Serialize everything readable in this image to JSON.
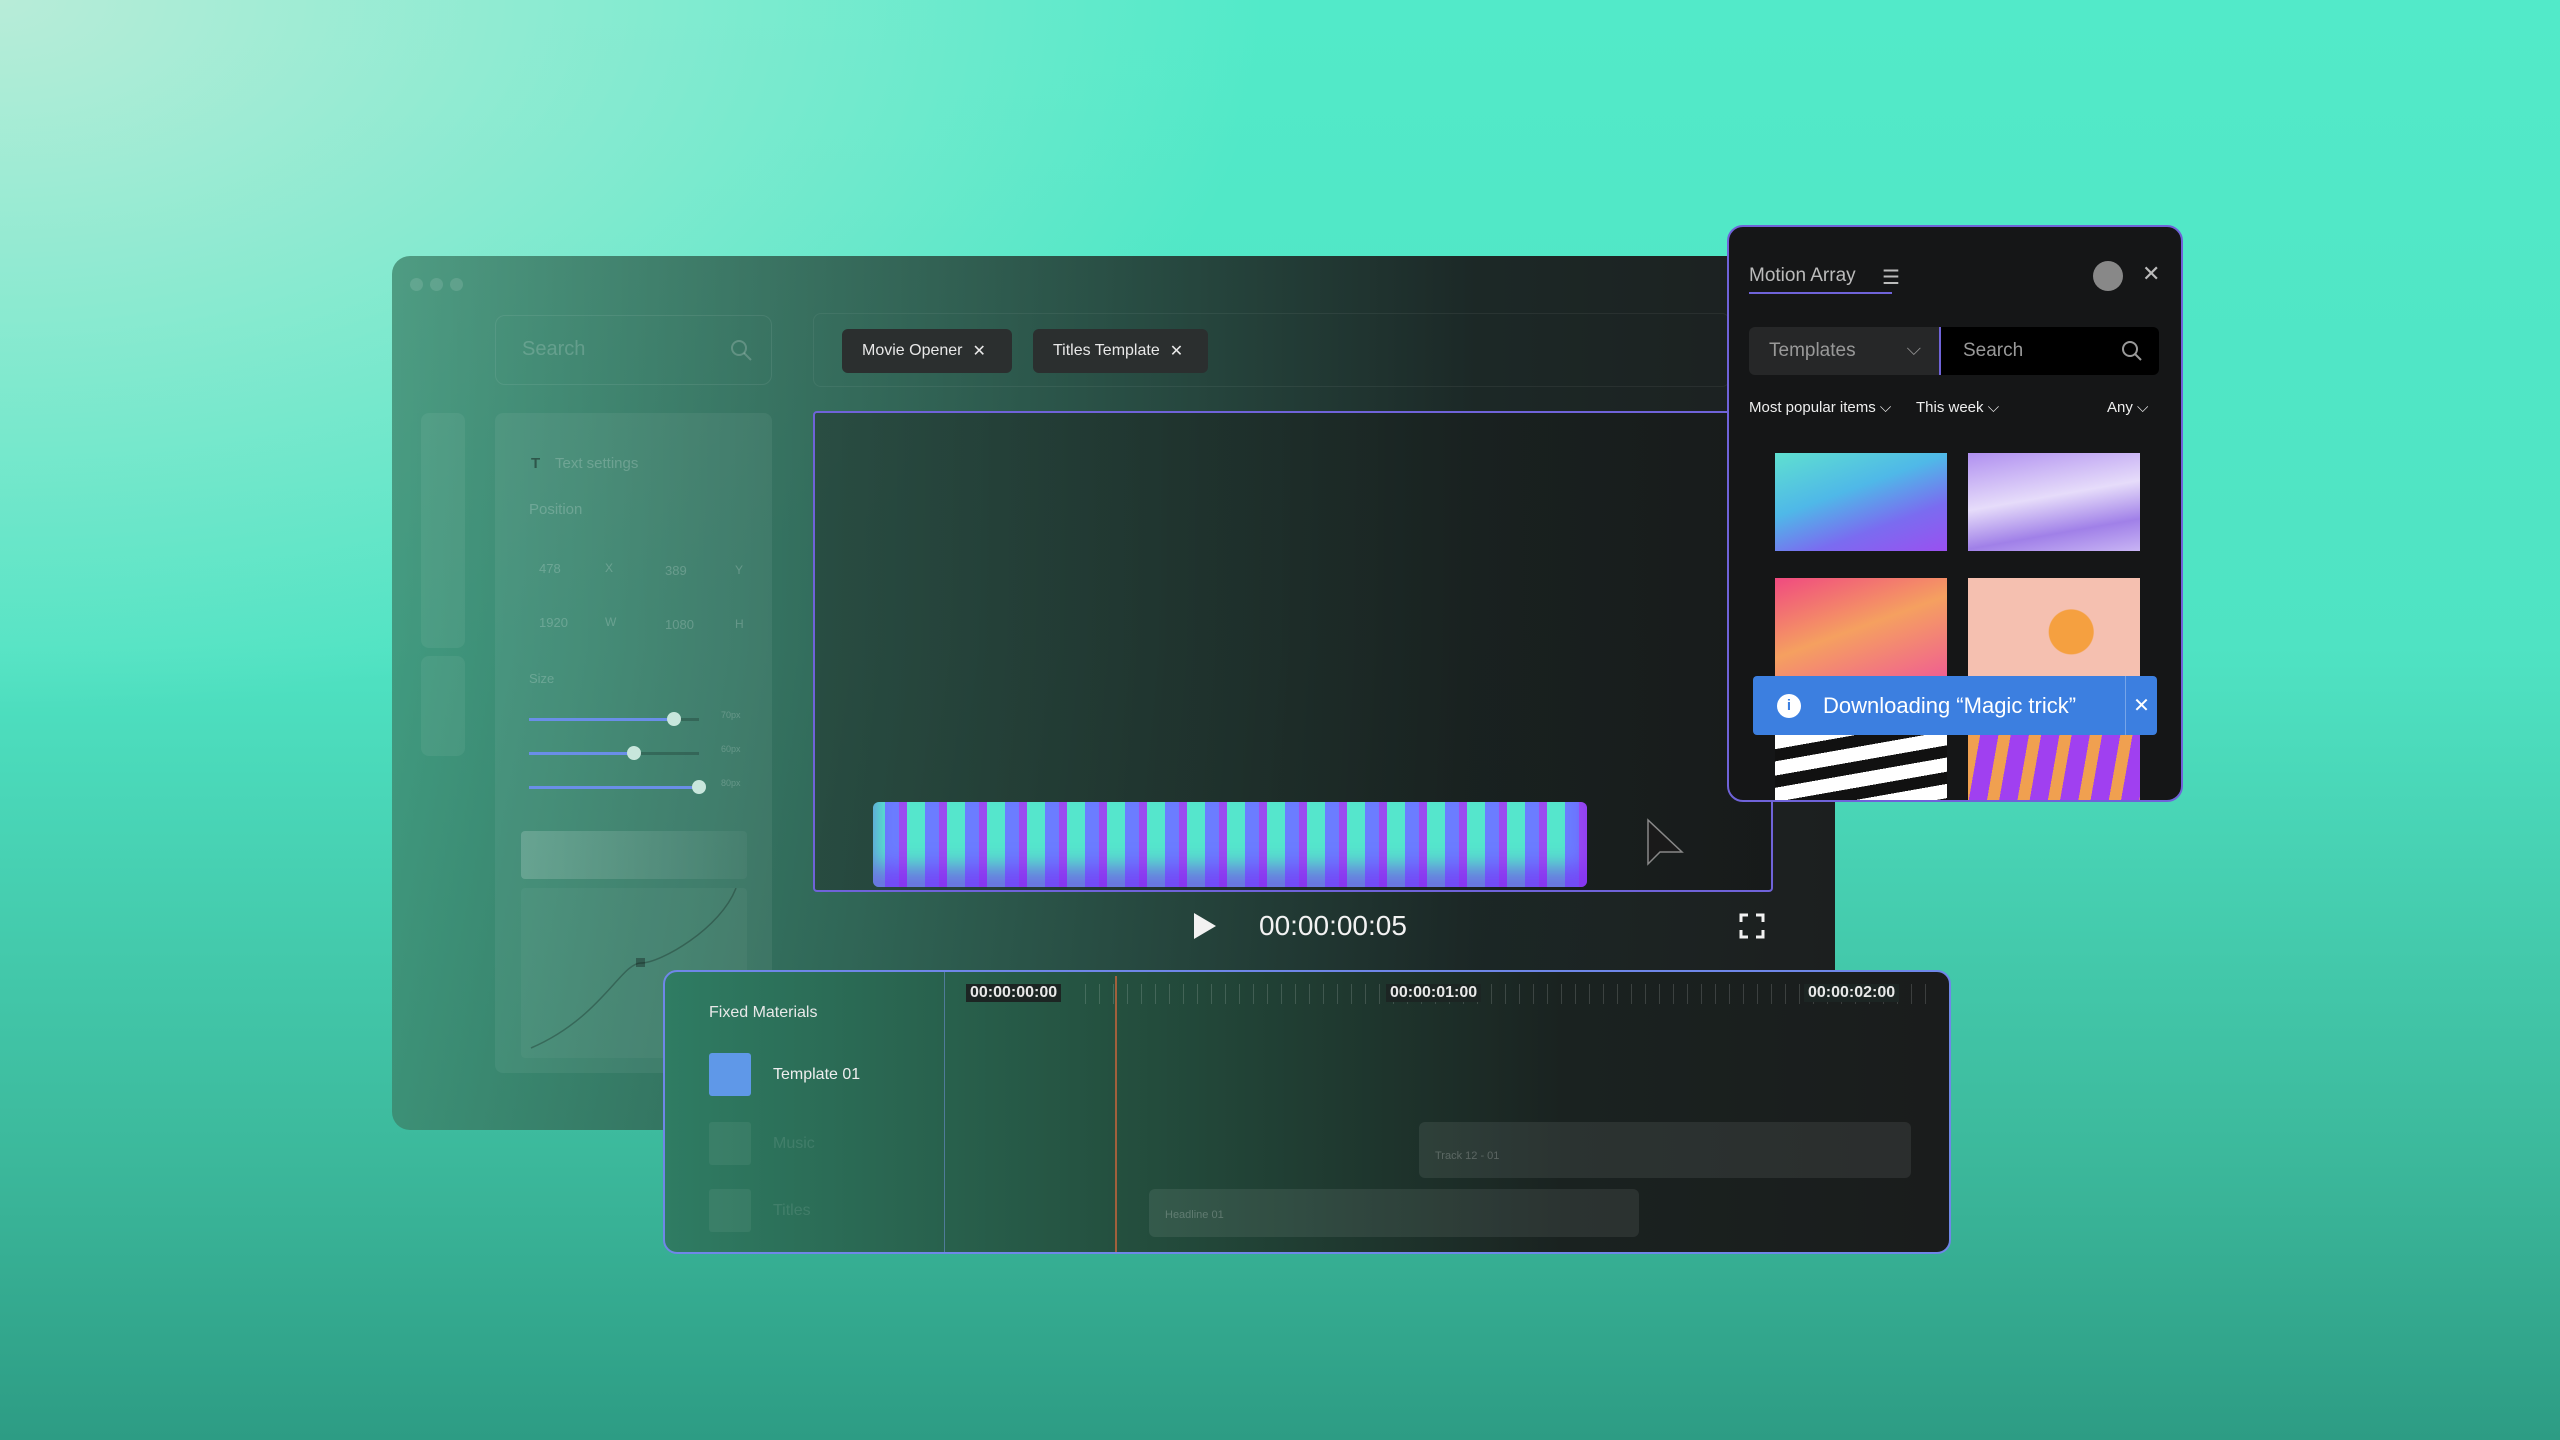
{
  "editor": {
    "search_placeholder": "Search",
    "text_settings": {
      "title": "Text settings",
      "position_label": "Position",
      "x": "478",
      "x_unit": "X",
      "y": "389",
      "y_unit": "Y",
      "w": "1920",
      "w_unit": "W",
      "h": "1080",
      "h_unit": "H",
      "size_label": "Size",
      "sliders": [
        {
          "label": "70px",
          "value": 0.85
        },
        {
          "label": "60px",
          "value": 0.62
        },
        {
          "label": "80px",
          "value": 1.0
        }
      ]
    },
    "tabs": [
      {
        "label": "Movie Opener"
      },
      {
        "label": "Titles Template"
      }
    ],
    "player": {
      "timecode": "00:00:00:05"
    },
    "timeline": {
      "header": "Fixed Materials",
      "ruler": [
        "00:00:00:00",
        "00:00:01:00",
        "00:00:02:00"
      ],
      "tracks": [
        {
          "label": "Template 01",
          "icon": "video-icon"
        },
        {
          "label": "Music",
          "icon": "audio-icon"
        },
        {
          "label": "Titles",
          "icon": "text-icon"
        }
      ],
      "clips": [
        {
          "label": "Track 12 - 01"
        },
        {
          "label": "Headline 01"
        }
      ]
    }
  },
  "motion_array": {
    "title": "Motion Array",
    "category": "Templates",
    "search_placeholder": "Search",
    "filters": {
      "sort": "Most popular items",
      "period": "This week",
      "type": "Any"
    },
    "toast": {
      "message": "Downloading “Magic trick”"
    },
    "accent": "#6f63d9",
    "toast_color": "#3c7fe0"
  }
}
